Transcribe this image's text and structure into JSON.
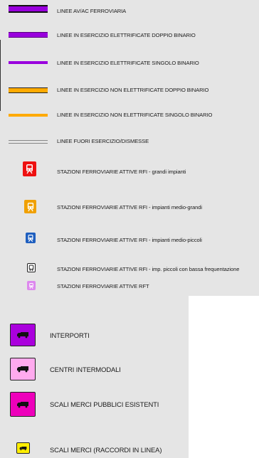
{
  "legend": {
    "lines": [
      {
        "label": "LINEE AV/AC FERROVIARIA",
        "icon": "high-speed-line-symbol",
        "color": "#9900dd"
      },
      {
        "label": "LINEE IN ESERCIZIO ELETTRIFICATE DOPPIO BINARIO",
        "icon": "electrified-double-track-symbol",
        "color": "#9900dd"
      },
      {
        "label": "LINEE IN ESERCIZIO ELETTRIFICATE SINGOLO BINARIO",
        "icon": "electrified-single-track-symbol",
        "color": "#9900dd"
      },
      {
        "label": "LINEE IN ESERCIZIO NON ELETTRIFICATE DOPPIO BINARIO",
        "icon": "non-electrified-double-track-symbol",
        "color": "#ffaa00"
      },
      {
        "label": "LINEE IN ESERCIZIO NON ELETTRIFICATE SINGOLO BINARIO",
        "icon": "non-electrified-single-track-symbol",
        "color": "#ffaa00"
      },
      {
        "label": "LINEE FUORI ESERCIZIO/DISMESSE",
        "icon": "disused-line-symbol",
        "color": "#888888"
      }
    ],
    "stations": [
      {
        "label": "STAZIONI FERROVIARIE ATTIVE RFI - grandi impianti",
        "icon": "train-station-large-icon",
        "color": "#ee1111"
      },
      {
        "label": "STAZIONI FERROVIARIE ATTIVE RFI - impianti medio-grandi",
        "icon": "train-station-medium-large-icon",
        "color": "#f0a000"
      },
      {
        "label": "STAZIONI FERROVIARIE ATTIVE RFI - impianti medio-piccoli",
        "icon": "train-station-medium-small-icon",
        "color": "#1f5fbf"
      },
      {
        "label": "STAZIONI FERROVIARIE ATTIVE RFI - imp. piccoli con bassa frequentazione",
        "icon": "train-station-small-icon",
        "color": "#ffffff"
      },
      {
        "label": "STAZIONI FERROVIARIE ATTIVE RFT",
        "icon": "train-station-rft-icon",
        "color": "#dd88ee"
      }
    ],
    "freight": [
      {
        "label": "INTERPORTI",
        "icon": "truck-interport-icon",
        "color": "#aa00dd"
      },
      {
        "label": "CENTRI INTERMODALI",
        "icon": "truck-intermodal-icon",
        "color": "#ffaaee"
      },
      {
        "label": "SCALI MERCI PUBBLICI ESISTENTI",
        "icon": "truck-freight-yard-icon",
        "color": "#ee00bb"
      },
      {
        "label": "SCALI MERCI (RACCORDI IN LINEA)",
        "icon": "truck-siding-icon",
        "color": "#ffee00"
      }
    ]
  }
}
